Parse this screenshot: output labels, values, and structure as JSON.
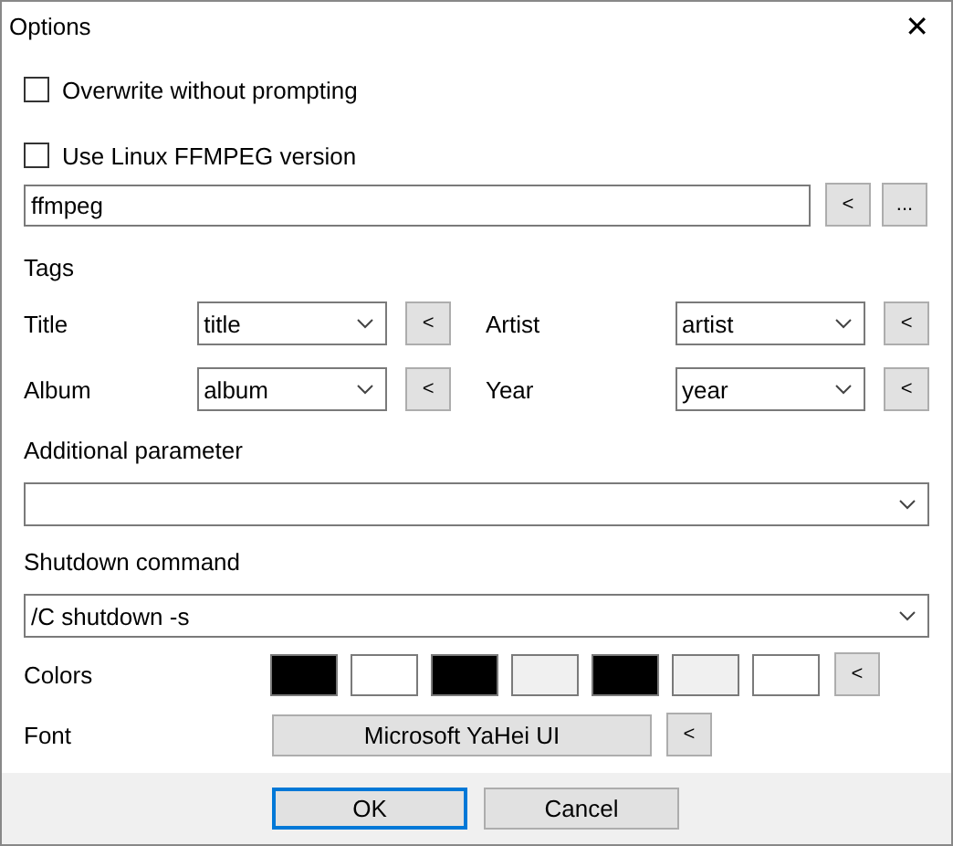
{
  "window": {
    "title": "Options",
    "close": "✕"
  },
  "checkboxes": [
    {
      "label": "Overwrite without prompting",
      "checked": false
    },
    {
      "label": "Use Linux FFMPEG version",
      "checked": false
    }
  ],
  "ffmpeg": {
    "value": "ffmpeg",
    "buttons": [
      "<",
      "..."
    ]
  },
  "tags": {
    "heading": "Tags",
    "fields": [
      {
        "label": "Title",
        "value": "title",
        "button": "<"
      },
      {
        "label": "Artist",
        "value": "artist",
        "button": "<"
      },
      {
        "label": "Album",
        "value": "album",
        "button": "<"
      },
      {
        "label": "Year",
        "value": "year",
        "button": "<"
      }
    ]
  },
  "additional_parameter": {
    "label": "Additional parameter"
  },
  "shutdown_command": {
    "label": "Shutdown command",
    "value": "/C shutdown -s"
  },
  "colors": {
    "label": "Colors",
    "swatches": [
      {
        "color": "#000000"
      },
      {
        "color": "#ffffff"
      },
      {
        "color": "#000000"
      },
      {
        "color": "#f0f0f0"
      },
      {
        "color": "#000000"
      },
      {
        "color": "#f0f0f0"
      },
      {
        "color": "#ffffff"
      }
    ],
    "button": "<"
  },
  "font": {
    "label": "Font",
    "value": "Microsoft YaHei UI",
    "button": "<"
  },
  "buttons": [
    {
      "label": "OK",
      "default": true
    },
    {
      "label": "Cancel",
      "default": false
    }
  ]
}
